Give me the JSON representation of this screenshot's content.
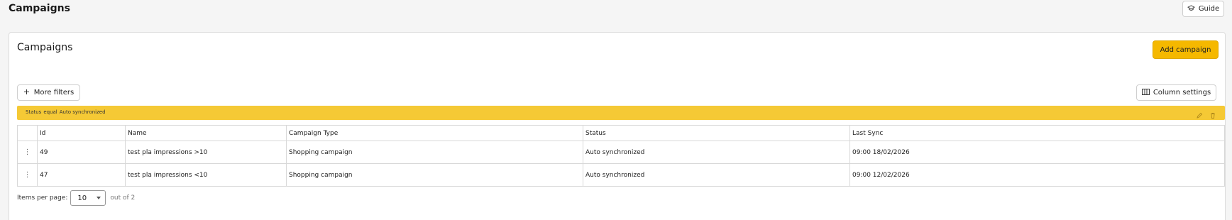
{
  "header": {
    "title": "Campaigns",
    "guide_label": "Guide"
  },
  "card": {
    "title": "Campaigns",
    "add_label": "Add campaign",
    "more_filters_label": "More filters",
    "column_settings_label": "Column settings"
  },
  "filter": {
    "field": "Status",
    "operator": "equal",
    "value": "Auto synchronized"
  },
  "table": {
    "columns": [
      "Id",
      "Name",
      "Campaign Type",
      "Status",
      "Last Sync"
    ],
    "rows": [
      {
        "id": "49",
        "name": "test pla impressions >10",
        "type": "Shopping campaign",
        "status": "Auto synchronized",
        "last_sync": "09:00 18/02/2026"
      },
      {
        "id": "47",
        "name": "test pla impressions <10",
        "type": "Shopping campaign",
        "status": "Auto synchronized",
        "last_sync": "09:00 12/02/2026"
      }
    ],
    "row_action_icon": "kebab-menu-icon"
  },
  "pagination": {
    "label": "Items per page:",
    "selected": "10",
    "total_text": "out of 2"
  },
  "colors": {
    "accent": "#f5b800",
    "filter_bar": "#f5c935",
    "background": "#f5f5f5"
  }
}
